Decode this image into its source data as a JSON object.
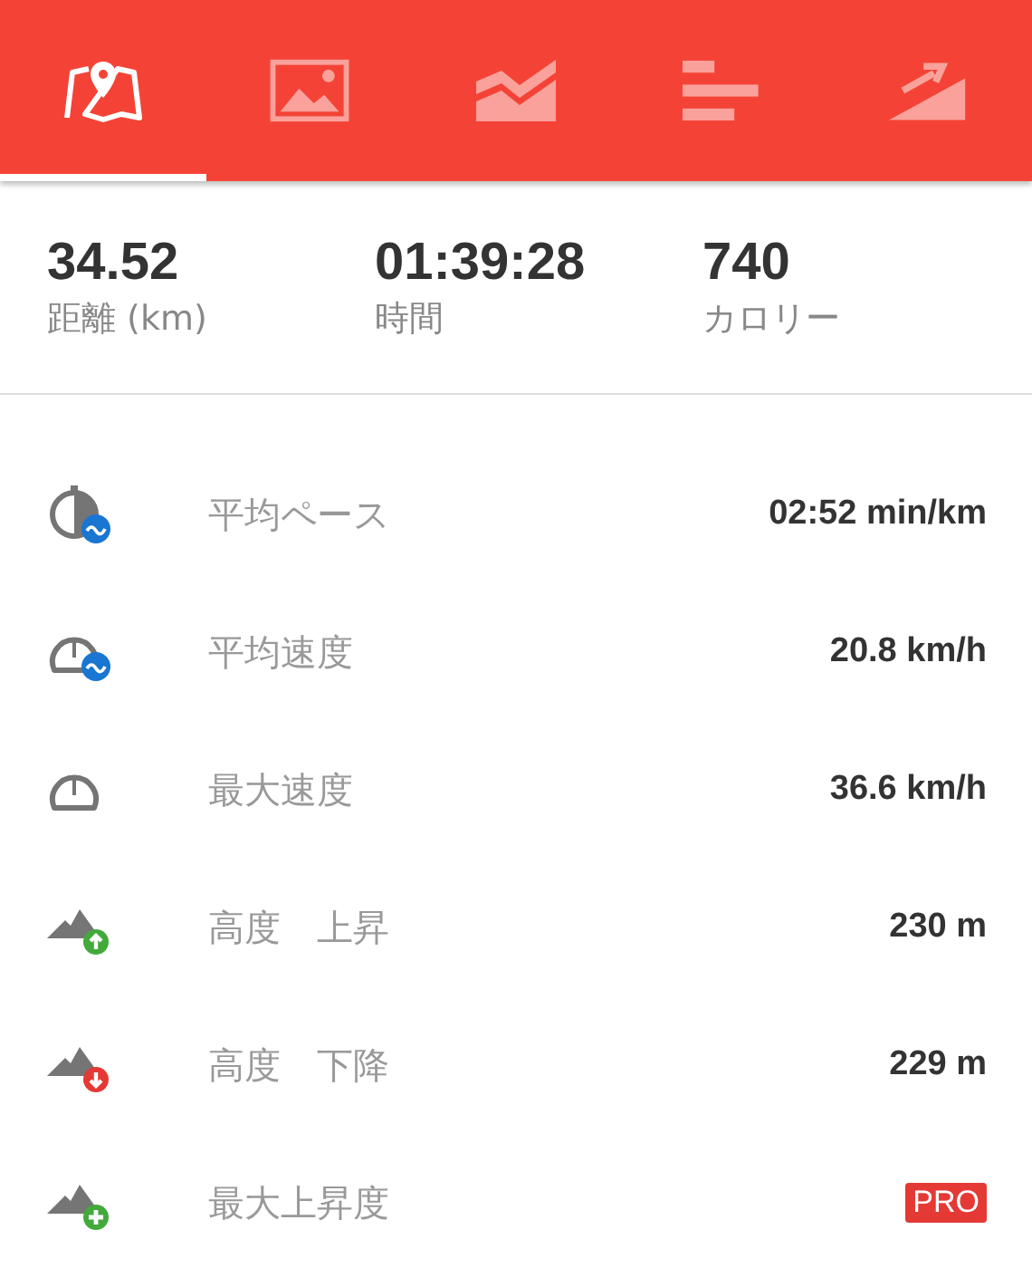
{
  "tabs": [
    {
      "kind": "map",
      "selected": true
    },
    {
      "kind": "photo",
      "selected": false
    },
    {
      "kind": "area",
      "selected": false
    },
    {
      "kind": "bars",
      "selected": false
    },
    {
      "kind": "climb",
      "selected": false
    }
  ],
  "summary": [
    {
      "value": "34.52",
      "label": "距離 (km)"
    },
    {
      "value": "01:39:28",
      "label": "時間"
    },
    {
      "value": "740",
      "label": "カロリー"
    }
  ],
  "rows": [
    {
      "kind": "pace",
      "label": "平均ペース",
      "value": "02:52 min/km"
    },
    {
      "kind": "avg_speed",
      "label": "平均速度",
      "value": "20.8 km/h"
    },
    {
      "kind": "max_speed",
      "label": "最大速度",
      "value": "36.6 km/h"
    },
    {
      "kind": "ascent",
      "label": "高度　上昇",
      "value": "230 m"
    },
    {
      "kind": "descent",
      "label": "高度　下降",
      "value": "229 m"
    },
    {
      "kind": "max_climb",
      "label": "最大上昇度",
      "badge": "PRO"
    }
  ]
}
